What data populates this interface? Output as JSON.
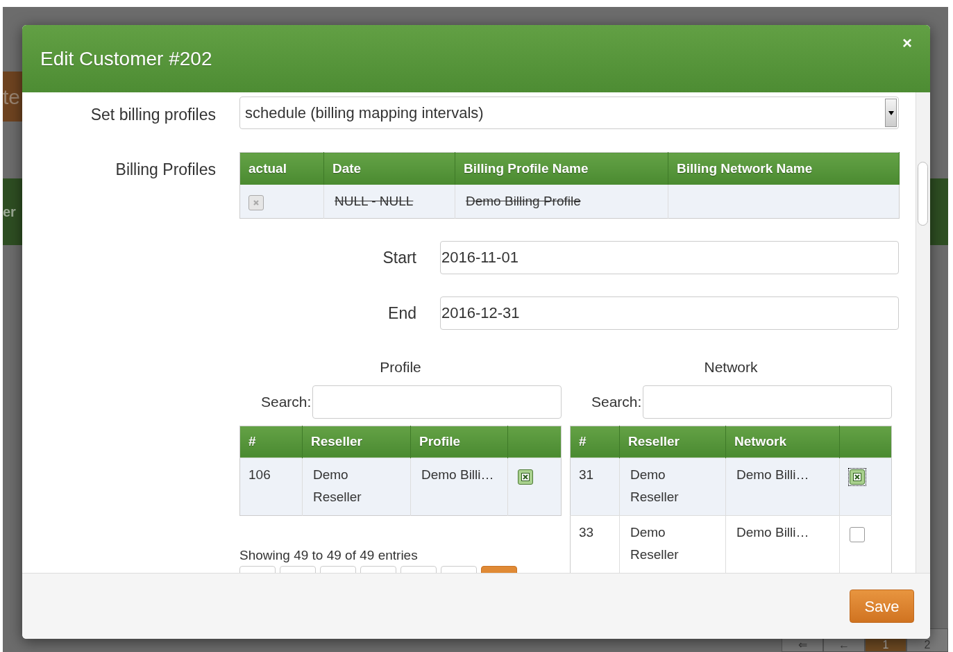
{
  "background": {
    "button_text": "te",
    "header_text": "er",
    "pagination": [
      {
        "label": "⇐",
        "selected": false
      },
      {
        "label": "←",
        "selected": false
      },
      {
        "label": "1",
        "selected": true
      },
      {
        "label": "2",
        "selected": false
      }
    ]
  },
  "modal": {
    "title": "Edit Customer #202",
    "close": "×"
  },
  "billing_mode": {
    "label": "Set billing profiles",
    "value": "schedule (billing mapping intervals)"
  },
  "billing_profiles": {
    "label": "Billing Profiles",
    "columns": [
      "actual",
      "Date",
      "Billing Profile Name",
      "Billing Network Name"
    ],
    "rows": [
      {
        "actual": false,
        "struck": true,
        "date": "NULL - NULL",
        "profile_name": "Demo Billing Profile"
      }
    ]
  },
  "start": {
    "label": "Start",
    "value": "2016-11-01"
  },
  "end": {
    "label": "End",
    "value": "2016-12-31"
  },
  "pickers": [
    {
      "title": "Profile",
      "search_label": "Search:",
      "columns": [
        "#",
        "Reseller",
        "Profile"
      ],
      "rows": [
        {
          "id": "106",
          "reseller": "Demo Reseller",
          "name": "Demo Billi…",
          "checked": true,
          "focused": false
        }
      ],
      "info": "Showing 49 to 49 of 49 entries",
      "pages": [
        {
          "selected": false
        },
        {
          "selected": false
        },
        {
          "selected": false
        },
        {
          "selected": false
        },
        {
          "selected": false
        },
        {
          "selected": false
        },
        {
          "selected": true
        }
      ]
    },
    {
      "title": "Network",
      "search_label": "Search:",
      "columns": [
        "#",
        "Reseller",
        "Network"
      ],
      "rows": [
        {
          "id": "31",
          "reseller": "Demo Reseller",
          "name": "Demo Billi…",
          "checked": true,
          "focused": true
        },
        {
          "id": "33",
          "reseller": "Demo Reseller",
          "name": "Demo Billi…",
          "checked": false,
          "focused": false
        }
      ]
    }
  ],
  "footer": {
    "save": "Save"
  }
}
